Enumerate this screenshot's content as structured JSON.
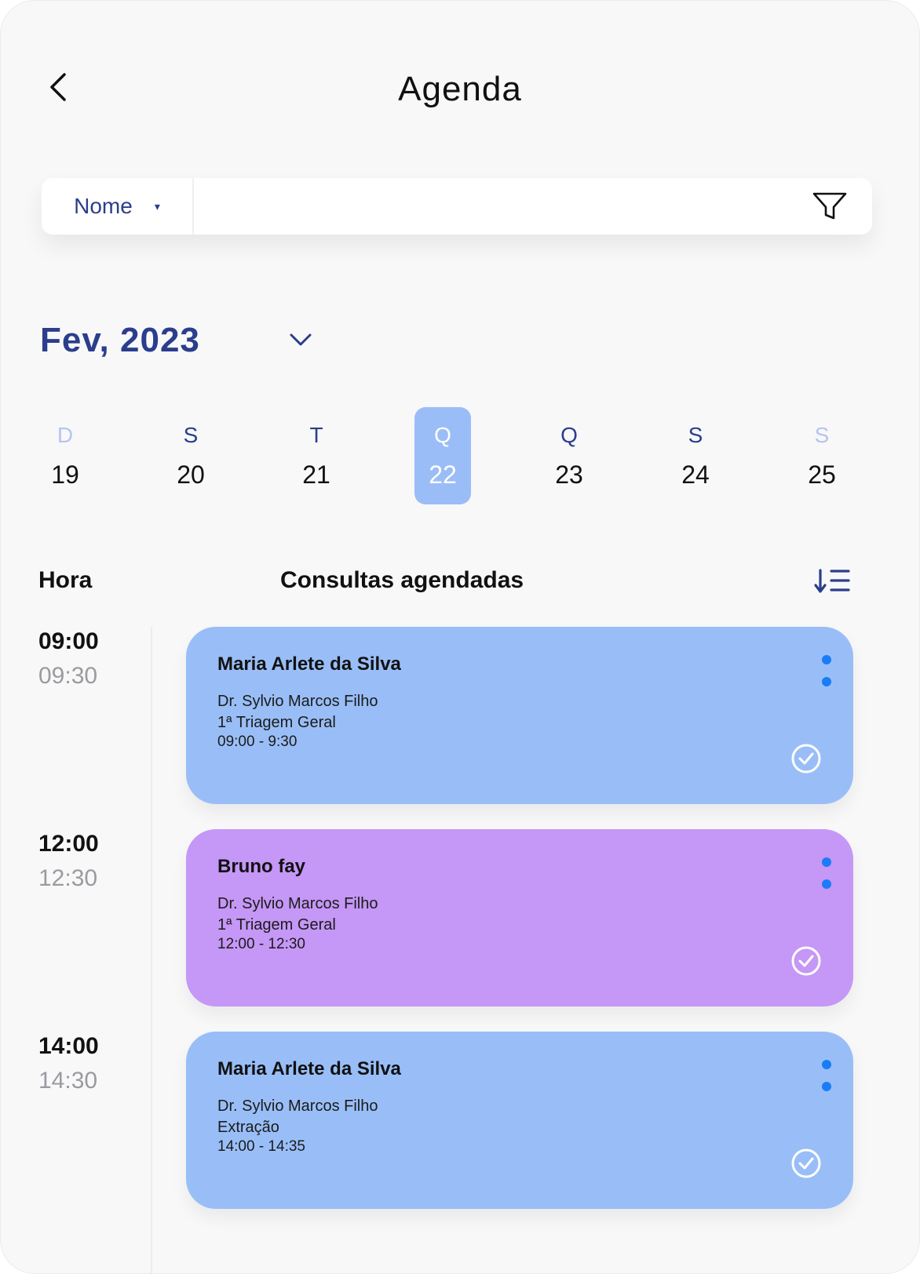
{
  "header": {
    "title": "Agenda",
    "back_icon": "chevron-left-icon"
  },
  "search": {
    "filter_field": "Nome",
    "caret": "▾",
    "value": "",
    "placeholder": "",
    "filter_icon": "funnel-icon"
  },
  "calendar": {
    "month_label": "Fev, 2023",
    "days": [
      {
        "dow": "D",
        "num": "19",
        "weekend": true,
        "selected": false
      },
      {
        "dow": "S",
        "num": "20",
        "weekend": false,
        "selected": false
      },
      {
        "dow": "T",
        "num": "21",
        "weekend": false,
        "selected": false
      },
      {
        "dow": "Q",
        "num": "22",
        "weekend": false,
        "selected": true
      },
      {
        "dow": "Q",
        "num": "23",
        "weekend": false,
        "selected": false
      },
      {
        "dow": "S",
        "num": "24",
        "weekend": false,
        "selected": false
      },
      {
        "dow": "S",
        "num": "25",
        "weekend": true,
        "selected": false
      }
    ]
  },
  "list": {
    "hour_header": "Hora",
    "appointments_header": "Consultas agendadas",
    "sort_icon": "sort-descending-icon"
  },
  "appointments": [
    {
      "start": "09:00",
      "end": "09:30",
      "patient": "Maria Arlete da Silva",
      "doctor": "Dr. Sylvio Marcos Filho",
      "procedure": "1ª Triagem Geral",
      "time_range": "09:00 - 9:30",
      "color": "#99bef7"
    },
    {
      "start": "12:00",
      "end": "12:30",
      "patient": "Bruno fay",
      "doctor": "Dr. Sylvio Marcos Filho",
      "procedure": "1ª Triagem Geral",
      "time_range": "12:00 - 12:30",
      "color": "#c597f6"
    },
    {
      "start": "14:00",
      "end": "14:30",
      "patient": "Maria Arlete da Silva",
      "doctor": "Dr. Sylvio Marcos Filho",
      "procedure": "Extração",
      "time_range": "14:00 - 14:35",
      "color": "#99bef7"
    }
  ],
  "colors": {
    "accent": "#2b3e8c",
    "selected_day": "#9bbdf7",
    "menu_dots": "#1a7cf6",
    "weekend_text": "#b6c5ef"
  }
}
